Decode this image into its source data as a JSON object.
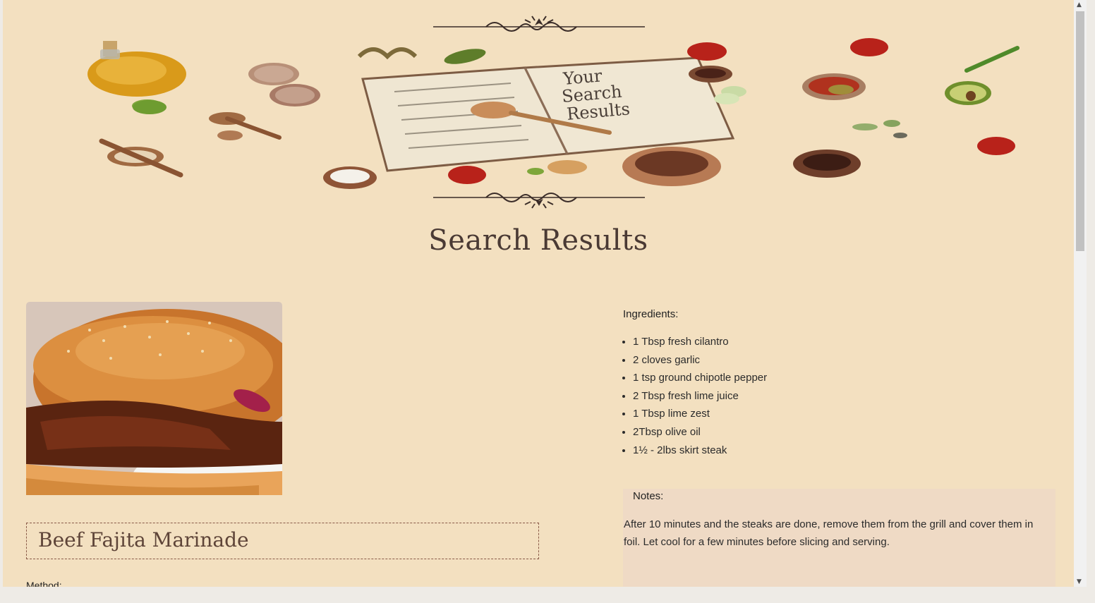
{
  "banner": {
    "book_text": [
      "Your",
      "Search",
      "Results"
    ]
  },
  "page": {
    "title": "Search Results"
  },
  "recipe": {
    "title": "Beef Fajita Marinade",
    "method_label": "Method:",
    "ingredients_heading": "Ingredients:",
    "ingredients": [
      "1 Tbsp fresh cilantro",
      "2 cloves garlic",
      "1 tsp ground chipotle pepper",
      "2 Tbsp fresh lime juice",
      "1 Tbsp lime zest",
      "2Tbsp olive oil",
      "1½ - 2lbs skirt steak"
    ],
    "notes_heading": "Notes:",
    "notes": "After 10 minutes and the steaks are done, remove them from the grill and cover them in foil. Let cool for a few minutes before slicing and serving."
  },
  "colors": {
    "background": "#f3e0c0",
    "notes_background": "#efdac5",
    "title_border": "#8a5a48"
  }
}
